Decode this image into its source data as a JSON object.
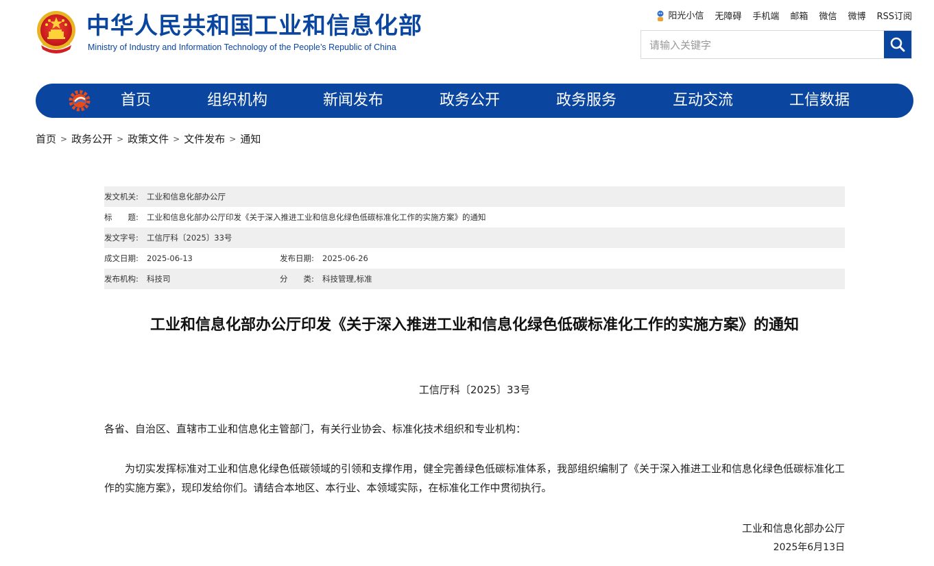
{
  "header": {
    "title_cn": "中华人民共和国工业和信息化部",
    "title_en": "Ministry of Industry and Information Technology of the People’s Republic of China",
    "top_links": [
      "阳光小信",
      "无障碍",
      "手机端",
      "邮箱",
      "微信",
      "微博",
      "RSS订阅"
    ],
    "search_placeholder": "请输入关键字"
  },
  "nav": {
    "items": [
      "首页",
      "组织机构",
      "新闻发布",
      "政务公开",
      "政务服务",
      "互动交流",
      "工信数据"
    ]
  },
  "breadcrumb": [
    "首页",
    "政务公开",
    "政策文件",
    "文件发布",
    "通知"
  ],
  "meta": {
    "issuer_label": "发文机关:",
    "issuer": "工业和信息化部办公厅",
    "title_label": "标　　题:",
    "title": "工业和信息化部办公厅印发《关于深入推进工业和信息化绿色低碳标准化工作的实施方案》的通知",
    "docno_label": "发文字号:",
    "docno": "工信厅科〔2025〕33号",
    "created_label": "成文日期:",
    "created": "2025-06-13",
    "published_label": "发布日期:",
    "published": "2025-06-26",
    "org_label": "发布机构:",
    "org": "科技司",
    "category_label": "分　　类:",
    "category": "科技管理,标准"
  },
  "article": {
    "title": "工业和信息化部办公厅印发《关于深入推进工业和信息化绿色低碳标准化工作的实施方案》的通知",
    "docno": "工信厅科〔2025〕33号",
    "salutation": "各省、自治区、直辖市工业和信息化主管部门，有关行业协会、标准化技术组织和专业机构：",
    "body": "为切实发挥标准对工业和信息化绿色低碳领域的引领和支撑作用，健全完善绿色低碳标准体系，我部组织编制了《关于深入推进工业和信息化绿色低碳标准化工作的实施方案》，现印发给你们。请结合本地区、本行业、本领域实际，在标准化工作中贯彻执行。",
    "sign_org": "工业和信息化部办公厅",
    "sign_date": "2025年6月13日"
  },
  "colors": {
    "brand_blue": "#0a46a0",
    "meta_gray": "#efefef"
  }
}
